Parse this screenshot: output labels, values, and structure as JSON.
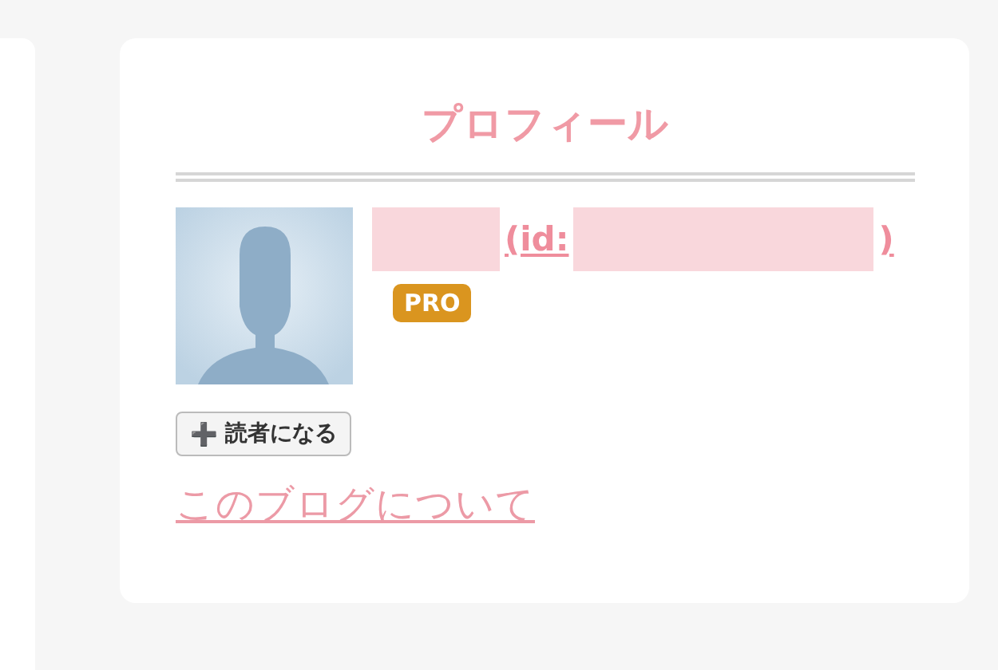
{
  "profile": {
    "title": "プロフィール",
    "user": {
      "id_open": "(id:",
      "id_close": ")",
      "redacted": true
    },
    "badge": "PRO",
    "follow_button": {
      "icon": "➕",
      "label": "読者になる"
    },
    "about_link": "このブログについて"
  }
}
